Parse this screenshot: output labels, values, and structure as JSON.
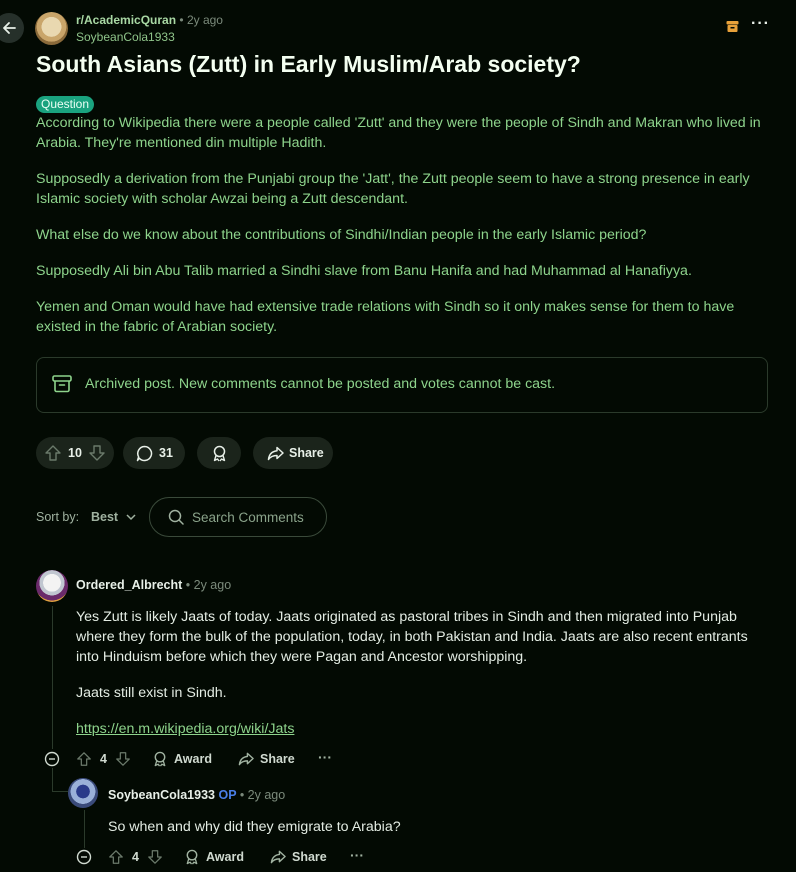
{
  "post": {
    "subreddit": "r/AcademicQuran",
    "post_age": "2y ago",
    "author": "SoybeanCola1933",
    "title": "South Asians (Zutt) in Early Muslim/Arab society?",
    "flair": "Question",
    "paragraphs": [
      "According to Wikipedia there were a people called 'Zutt' and they were the people of Sindh and Makran who lived in Arabia. They're mentioned din multiple Hadith.",
      "Supposedly a derivation from the Punjabi group the 'Jatt', the Zutt people seem to have a strong presence in early Islamic society with scholar Awzai being a Zutt descendant.",
      "What else do we know about the contributions of Sindhi/Indian people in the early Islamic period?",
      "Supposedly Ali bin Abu Talib married a Sindhi slave from Banu Hanifa and had Muhammad al Hanafiyya.",
      "Yemen and Oman would have had extensive trade relations with Sindh so it only makes sense for them to have existed in the fabric of Arabian society."
    ],
    "archived_notice": "Archived post. New comments cannot be posted and votes cannot be cast.",
    "votes": "10",
    "comments_count": "31",
    "share_label": "Share"
  },
  "sort": {
    "label": "Sort by:",
    "value": "Best",
    "search_placeholder": "Search Comments"
  },
  "comments": [
    {
      "author": "Ordered_Albrecht",
      "age": "2y ago",
      "paragraphs": [
        "Yes Zutt is likely Jaats of today. Jaats originated as pastoral tribes in Sindh and then migrated into Punjab where they form the bulk of the population, today, in both Pakistan and India. Jaats are also recent entrants into Hinduism before which they were Pagan and Ancestor worshipping.",
        "Jaats still exist in Sindh."
      ],
      "link": "https://en.m.wikipedia.org/wiki/Jats",
      "votes": "4",
      "award_label": "Award",
      "share_label": "Share"
    },
    {
      "author": "SoybeanCola1933",
      "op_tag": "OP",
      "age": "2y ago",
      "text": "So when and why did they emigrate to Arabia?",
      "votes": "4",
      "award_label": "Award",
      "share_label": "Share"
    }
  ],
  "icons": {
    "back": "arrow-left-icon",
    "archive": "archive-icon",
    "more": "more-icon",
    "upvote": "upvote-icon",
    "downvote": "downvote-icon",
    "comment": "comment-icon",
    "award": "award-icon",
    "share": "share-icon",
    "search": "search-icon",
    "collapse": "collapse-icon"
  },
  "colors": {
    "background": "#030a03",
    "accent_text": "#8ed48c",
    "flair": "#1aa37f",
    "op": "#4a7fe8",
    "archive_icon": "#e8a13a"
  }
}
